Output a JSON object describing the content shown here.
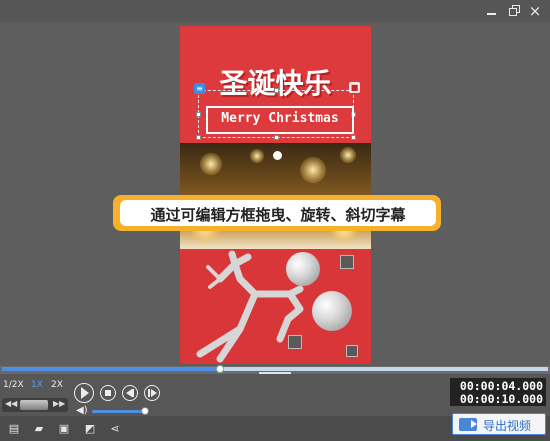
{
  "window": {
    "minimize_icon": "minimize-icon",
    "restore_icon": "restore-icon",
    "close_label": "×"
  },
  "preview": {
    "title_text": "圣诞快乐",
    "subtitle_text": "Merry Christmas",
    "banner_text": "通过可编辑方框拖曳、旋转、斜切字幕",
    "accent_color": "#dc3a3c",
    "banner_color": "#f5b12a"
  },
  "timeline": {
    "progress": 0.4,
    "collapse_label": "⌄"
  },
  "controls": {
    "speeds": [
      {
        "label": "1/2X",
        "active": false
      },
      {
        "label": "1X",
        "active": true
      },
      {
        "label": "2X",
        "active": false
      }
    ],
    "shuttle_left": "◀◀",
    "shuttle_right": "▶▶",
    "volume_level": 0.95,
    "current_time": "00:00:04.000",
    "total_time": "00:00:10.000"
  },
  "toolbar": {
    "icons": [
      "new-project-icon",
      "open-folder-icon",
      "save-icon",
      "save-as-icon",
      "share-icon"
    ],
    "export_label": "导出视频",
    "export_color": "#4a86d8"
  }
}
